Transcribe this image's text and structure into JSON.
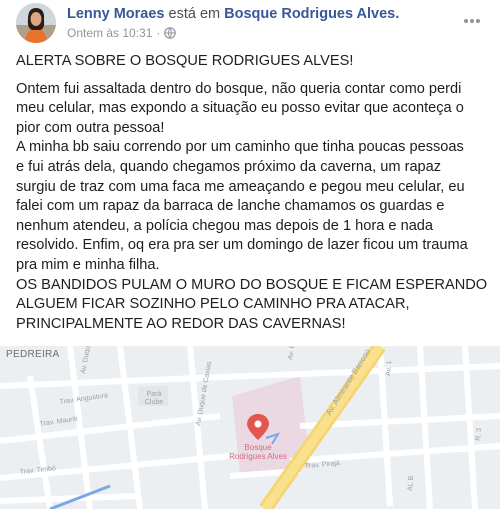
{
  "header": {
    "author": "Lenny Moraes",
    "verb": "está em",
    "place": "Bosque Rodrigues Alves.",
    "timestamp": "Ontem às 10:31",
    "separator": "·",
    "privacy_icon": "globe-icon",
    "more_icon": "more-horizontal-icon"
  },
  "post": {
    "lines": [
      "ALERTA SOBRE O BOSQUE RODRIGUES ALVES!",
      "Ontem fui assaltada dentro do bosque, não queria contar como perdi",
      "meu celular, mas expondo a situação eu posso evitar que aconteça o",
      "pior com outra pessoa!",
      "A minha bb saiu correndo por um caminho que tinha poucas pessoas",
      "e fui atrás dela, quando chegamos próximo da caverna, um rapaz",
      "surgiu de traz com uma faca me ameaçando e pegou meu celular,  eu",
      "falei com    um rapaz da barraca de lanche chamamos os guardas e",
      "nenhum atendeu, a polícia chegou mas depois de 1 hora e nada",
      "resolvido.  Enfim, oq era pra ser um domingo de lazer ficou um trauma",
      "pra mim e minha filha.",
      "OS BANDIDOS PULAM O MURO DO BOSQUE E FICAM ESPERANDO",
      "ALGUEM FICAR SOZINHO PELO CAMINHO PRA ATACAR,",
      "PRINCIPALMENTE AO REDOR DAS CAVERNAS!"
    ]
  },
  "map": {
    "neighborhood": "PEDREIRA",
    "pin_label_line1": "Bosque",
    "pin_label_line2": "Rodrigues Alves",
    "poi_line1": "Pará",
    "poi_line2": "Clube",
    "streets": [
      "Av. Almirante Barroso",
      "Av. Duque de Caxias",
      "Av. Duque de Caxias",
      "Trav. Angustura",
      "Trav. Mauriti",
      "Trav. Timbó",
      "Trav. Pirajá",
      "Av. R",
      "Av. 1",
      "R. 3",
      "AL B"
    ],
    "colors": {
      "background": "#eceff1",
      "street": "#ffffff",
      "highway": "#f7d774",
      "park": "#e8d7e0",
      "pin": "#e5554f",
      "transit": "#7aa7e8"
    }
  }
}
